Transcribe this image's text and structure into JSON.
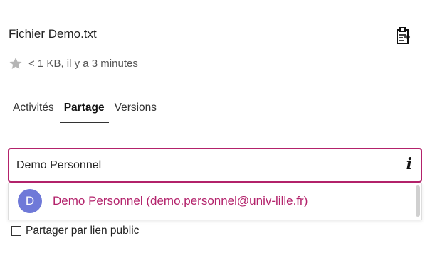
{
  "file": {
    "title": "Fichier Demo.txt",
    "meta": "< 1 KB, il y a 3 minutes"
  },
  "icons": {
    "details": "clipboard-details-icon",
    "favorite": "star-icon",
    "info": "info-icon"
  },
  "tabs": [
    {
      "label": "Activités",
      "active": false
    },
    {
      "label": "Partage",
      "active": true
    },
    {
      "label": "Versions",
      "active": false
    }
  ],
  "share": {
    "input_value": "Demo Personnel",
    "info_glyph": "i",
    "suggestions": [
      {
        "avatar_letter": "D",
        "label": "Demo Personnel (demo.personnel@univ-lille.fr)",
        "avatar_color": "#6f79d8"
      }
    ]
  },
  "public_link": {
    "label": "Partager par lien public",
    "checked": false
  },
  "colors": {
    "accent": "#b3226b",
    "avatar": "#6f79d8",
    "star": "#b5b5b5"
  }
}
